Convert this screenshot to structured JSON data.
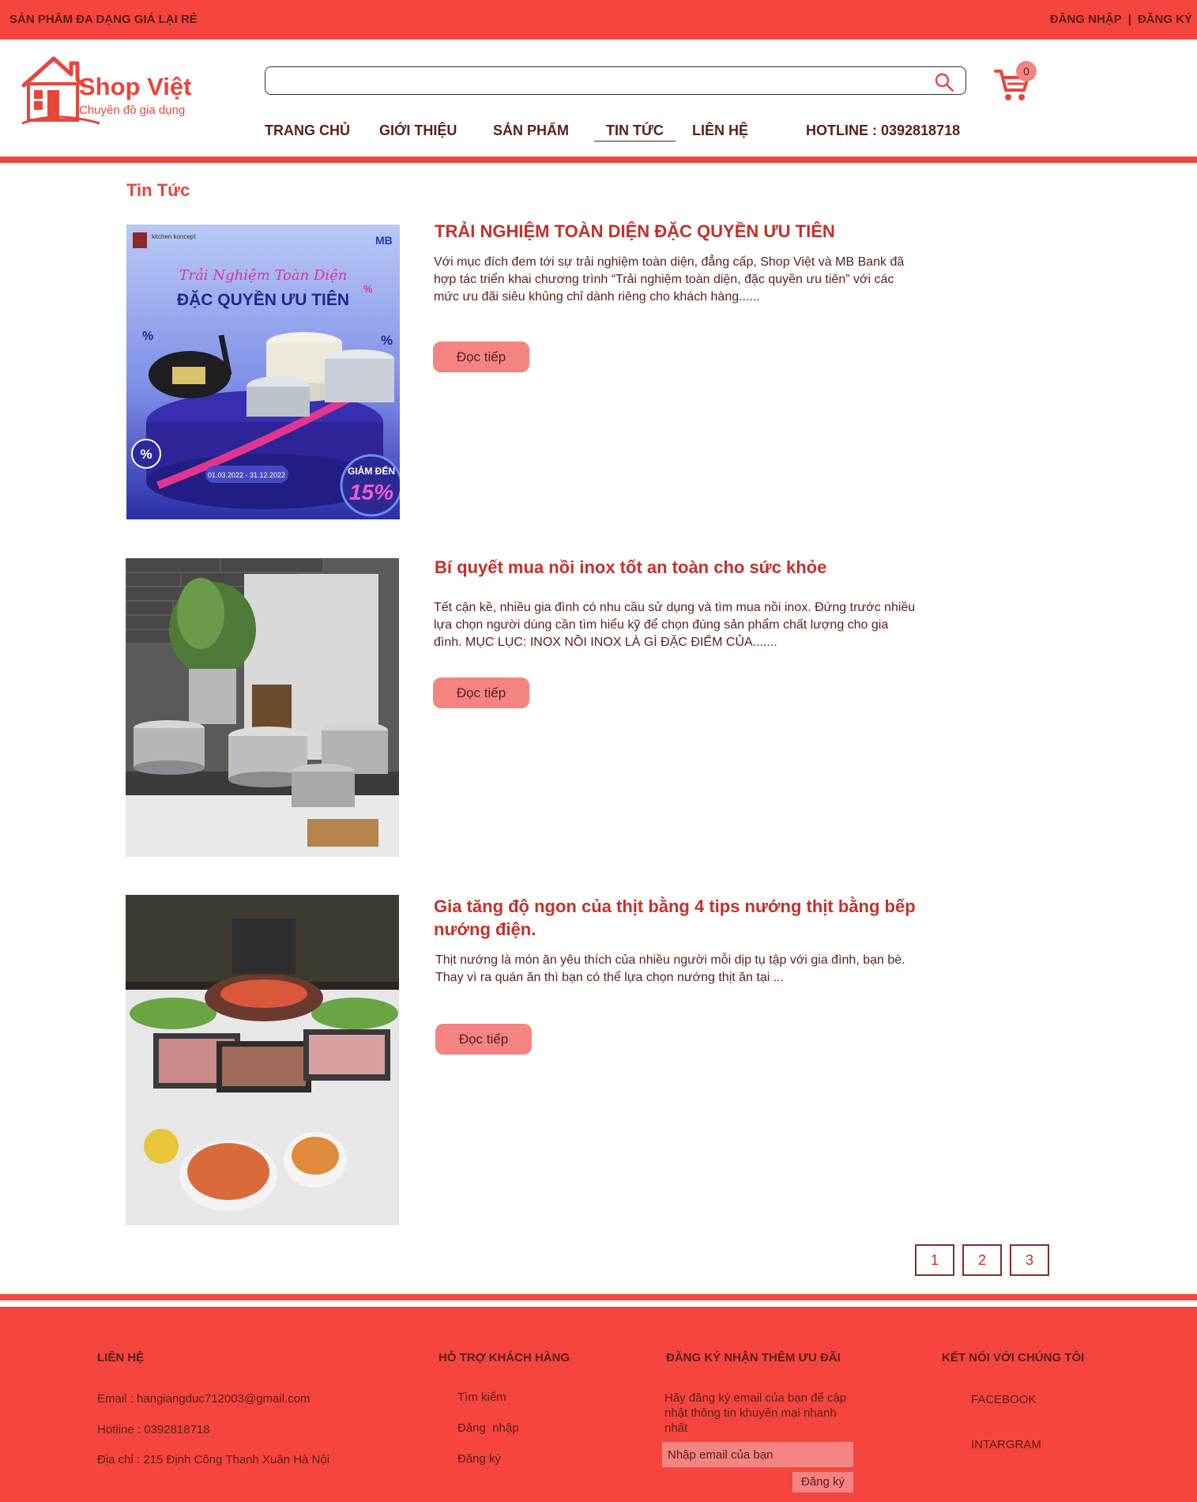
{
  "topbar": {
    "promo": "SẢN PHẨM ĐA DẠNG GIÁ LẠI RẺ",
    "login": "ĐĂNG NHẬP",
    "separator": "|",
    "register": "ĐĂNG KÝ"
  },
  "logo": {
    "brand": "Shop Việt",
    "tagline": "Chuyên đồ gia dụng"
  },
  "search": {
    "placeholder": "",
    "icon": "search-icon"
  },
  "cart": {
    "count": "0",
    "icon": "shopping-cart-icon"
  },
  "nav": {
    "items": [
      {
        "label": "TRANG CHỦ",
        "active": false
      },
      {
        "label": "GIỚI THIỆU",
        "active": false
      },
      {
        "label": "SẢN PHẨM",
        "active": false
      },
      {
        "label": "TIN TỨC",
        "active": true
      },
      {
        "label": "LIÊN HỆ",
        "active": false
      }
    ],
    "hotline": "HOTLINE : 0392818718"
  },
  "section_title": "Tin Tức",
  "articles": [
    {
      "title": "TRẢI NGHIỆM TOÀN DIỆN ĐẶC QUYỀN ƯU TIÊN",
      "excerpt": "Với mục đích đem tới sự trải nghiệm toàn diện, đẳng cấp, Shop Việt và MB Bank đã hợp tác triển khai chương trình “Trải nghiệm toàn diện, đặc quyền ưu tiên” với các mức ưu đãi siêu khủng chỉ dành riêng cho khách hàng......",
      "read_more": "Đọc tiếp",
      "image": {
        "brand": "kitchen koncept",
        "bank": "MB",
        "script_line": "Trải Nghiệm Toàn Diện",
        "headline": "ĐẶC QUYỀN ƯU TIÊN",
        "discount_label": "GIẢM ĐẾN",
        "discount": "15%",
        "dates": "01.03.2022 - 31.12.2022"
      }
    },
    {
      "title": "Bí quyết mua nồi inox tốt an toàn cho sức khỏe",
      "excerpt": "Tết cận kề, nhiều gia đình có nhu cầu sử dụng và tìm mua nồi inox. Đứng trước nhiều lựa chọn người dùng cần tìm hiểu kỹ để chọn đúng sản phẩm chất lượng cho gia đình. MỤC LỤC: INOX NỒI INOX LÀ GÌ ĐẶC ĐIỂM CỦA.......",
      "read_more": "Đọc tiếp"
    },
    {
      "title": "Gia tăng độ ngon của thịt bằng 4 tips nướng thịt bằng bếp nướng điện.",
      "excerpt": "Thịt nướng là món ăn yêu thích của nhiều người mỗi dịp tụ tập với gia đình, bạn bè. Thay vì ra quán ăn thì bạn có thể lựa chọn nướng thịt ăn tại ...",
      "read_more": "Đọc tiếp"
    }
  ],
  "pagination": [
    "1",
    "2",
    "3"
  ],
  "footer": {
    "contact": {
      "heading": "LIÊN HỆ",
      "email": "Email : hangiangduc712003@gmail.com",
      "hotline": "Hotline : 0392818718",
      "address": "Địa chỉ : 215 Định Công Thanh Xuân Hà Nội"
    },
    "support": {
      "heading": "HỖ TRỢ KHÁCH HÀNG",
      "links": [
        "Tìm kiếm",
        "Đăng  nhập",
        "Đăng ký"
      ]
    },
    "newsletter": {
      "heading": "ĐĂNG KÝ NHẬN THÊM ƯU ĐÃI",
      "text": "Hãy đăng ký email của bạn để cập nhật thông tin khuyến mại nhanh nhất",
      "placeholder": "Nhập email của bạn",
      "button": "Đăng ký"
    },
    "social": {
      "heading": "KẾT NỐI VỚI CHÚNG TÔI",
      "links": [
        "FACEBOOK",
        "INTARGRAM"
      ]
    }
  },
  "colors": {
    "brand_red": "#f5453e",
    "title_red": "#c4302b",
    "button_pink": "#f48482",
    "text_dark": "#5a1f1a"
  }
}
